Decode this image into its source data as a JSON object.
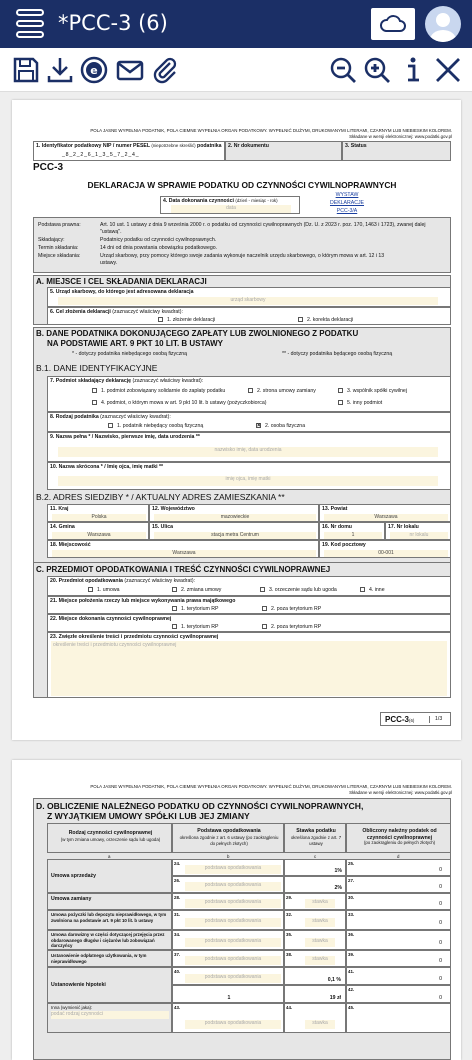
{
  "app": {
    "title": "*PCC-3 (6)"
  },
  "header_hint": "POLA JASNE WYPEŁNIA PODATNIK, POLA CIEMNE WYPEŁNIA ORGAN PODATKOWY. WYPEŁNIĆ DUŻYMI, DRUKOWANYMI LITERAMI, CZARNYM LUB NIEBIESKIM KOLOREM.",
  "header_hint2": "Składane w wersji elektronicznej: www.podatki.gov.pl",
  "field1": {
    "label": "1. Identyfikator podatkowy NIP / numer PESEL",
    "note": "(niepotrzebne skreślić)",
    "suffix": "podatnika",
    "value": "_8_2_2_6_1_3_5_7_2_4_"
  },
  "field2": {
    "label": "2. Nr dokumentu"
  },
  "field3": {
    "label": "3. Status"
  },
  "form_code": "PCC-3",
  "form_title": "DEKLARACJA W SPRAWIE PODATKU OD CZYNNOŚCI CYWILNOPRAWNYCH",
  "field4": {
    "label": "4. Data dokonania czynności",
    "note": "(dzień - miesiąc - rok)",
    "placeholder": "data"
  },
  "links": [
    "WYSTAW",
    "DEKLARACJE",
    "PCC-3/A"
  ],
  "legal": {
    "k1": "Podstawa prawna:",
    "v1": "Art. 10 ust. 1 ustawy z dnia 9 września 2000 r. o podatku od czynności cywilnoprawnych (Dz. U. z 2023 r. poz. 170, 1463 i 1723), zwanej dalej \"ustawą\".",
    "k2": "Składający:",
    "v2": "Podatnicy podatku od czynności cywilnoprawnych.",
    "k3": "Termin składania:",
    "v3": "14 dni od dnia powstania obowiązku podatkowego.",
    "k4": "Miejsce składania:",
    "v4": "Urząd skarbowy, przy pomocy którego swoje zadania wykonuje naczelnik urzędu skarbowego, o którym mowa w art. 12 i 13 ustawy."
  },
  "secA": {
    "title": "A. MIEJSCE I CEL SKŁADANIA DEKLARACJI",
    "f5": "5. Urząd skarbowy, do którego jest adresowana deklaracja",
    "f5_ph": "urząd skarbowy",
    "f6": "6. Cel złożenia deklaracji",
    "f6_note": "(zaznaczyć właściwy kwadrat):",
    "opt1": "1. złożenie deklaracji",
    "opt2": "2. korekta deklaracji"
  },
  "secB": {
    "title1": "B. DANE PODATNIKA DOKONUJĄCEGO ZAPŁATY LUB ZWOLNIONEGO Z PODATKU",
    "title2": "NA PODSTAWIE ART. 9 PKT 10 LIT. B USTAWY",
    "note1": "* - dotyczy podatnika niebędącego osobą fizyczną",
    "note2": "** - dotyczy podatnika będącego osobą fizyczną",
    "b1": "B.1. DANE IDENTYFIKACYJNE",
    "f7": "7. Podmiot składający deklarację",
    "f7_note": "(zaznaczyć właściwy kwadrat):",
    "f7_opts": [
      "1. podmiot zobowiązany solidarnie do zapłaty podatku",
      "2. strona umowy zamiany",
      "3. wspólnik spółki cywilnej",
      "4. podmiot, o którym mowa w art. 9 pkt 10 lit. b ustawy (pożyczkobiorca)",
      "5. inny podmiot"
    ],
    "f8": "8. Rodzaj podatnika",
    "f8_note": "(zaznaczyć właściwy kwadrat):",
    "f8_opts": [
      "1. podatnik niebędący osobą fizyczną",
      "2. osoba fizyczna"
    ],
    "f9": "9. Nazwa pełna * / Nazwisko, pierwsze imię, data urodzenia **",
    "f9_ph": "nazwisko imię, data urodzenia",
    "f10": "10. Nazwa skrócona * / Imię ojca, imię matki **",
    "f10_ph": "imię ojca, imię matki",
    "b2": "B.2. ADRES SIEDZIBY * / AKTUALNY ADRES ZAMIESZKANIA **",
    "addr": {
      "f11": "11. Kraj",
      "v11": "Polska",
      "f12": "12. Województwo",
      "v12": "mazowieckie",
      "f13": "13. Powiat",
      "v13": "Warszawa",
      "f14": "14. Gmina",
      "v14": "Warszawa",
      "f15": "15. Ulica",
      "v15": "stacja metra Centrum",
      "f16": "16. Nr domu",
      "v16": "1",
      "f17": "17. Nr lokalu",
      "v17": "nr lokalu",
      "f18": "18. Miejscowość",
      "v18": "Warszawa",
      "f19": "19. Kod pocztowy",
      "v19": "00-001"
    }
  },
  "secC": {
    "title": "C. PRZEDMIOT OPODATKOWANIA I TREŚĆ CZYNNOŚCI CYWILNOPRAWNEJ",
    "f20": "20. Przedmiot opodatkowania",
    "f20_note": "(zaznaczyć właściwy kwadrat):",
    "f20_opts": [
      "1. umowa",
      "2. zmiana umowy",
      "3. orzeczenie sądu lub ugoda",
      "4. inne"
    ],
    "f21": "21. Miejsce położenia rzeczy lub miejsce wykonywania prawa majątkowego",
    "f21_opts": [
      "1. terytorium RP",
      "2. poza terytorium RP"
    ],
    "f22": "22. Miejsce dokonania czynności cywilnoprawnej",
    "f22_opts": [
      "1. terytorium RP",
      "2. poza terytorium RP"
    ],
    "f23": "23. Zwięzłe określenie treści i przedmiotu czynności cywilnoprawnej",
    "f23_ph": "określenie treści i przedmiotu czynności cywilnoprawnej"
  },
  "footer": {
    "code": "PCC-3",
    "ver": "(6)",
    "page": "1/3"
  },
  "secD": {
    "title1": "D. OBLICZENIE NALEŻNEGO PODATKU OD CZYNNOŚCI CYWILNOPRAWNYCH,",
    "title2": "Z WYJĄTKIEM UMOWY SPÓŁKI LUB JEJ ZMIANY",
    "col_a": "Rodzaj czynności cywilnoprawnej",
    "col_a2": "(w tym zmiana umowy, orzeczenie sądu lub ugoda)",
    "col_b": "Podstawa opodatkowania",
    "col_b2": "określona zgodnie z art. 6 ustawy (po zaokrągleniu do pełnych złotych)",
    "col_c": "Stawka podatku",
    "col_c2": "określona zgodnie z art. 7 ustawy",
    "col_d": "Obliczony należny podatek od czynności cywilnoprawnej",
    "col_d2": "(po zaokrągleniu do pełnych złotych)",
    "letters": [
      "a",
      "b",
      "c",
      "d"
    ],
    "unit_zl": "zł",
    "rows": [
      {
        "label": "Umowa sprzedaży",
        "nb": "24.",
        "nc": "25.",
        "b": "podstawa opodatkowania",
        "c": "1%",
        "d": "0",
        "nb2": "26.",
        "nc2": "27.",
        "c2": "2%",
        "d2": "0"
      },
      {
        "label": "Umowa zamiany",
        "nb": "28.",
        "nc": "29.",
        "nd": "30.",
        "b": "podstawa opodatkowania",
        "c": "stawka",
        "d": "0"
      },
      {
        "label": "Umowa pożyczki lub depozytu nieprawidłowego, w tym zwolniona na podstawie art. 9 pkt 10 lit. b ustawy",
        "nb": "31.",
        "nc": "32.",
        "nd": "33.",
        "b": "podstawa opodatkowania",
        "c": "stawka",
        "d": "0"
      },
      {
        "label": "Umowa darowizny w części dotyczącej przejęcia przez obdarowanego długów i ciężarów lub zobowiązań darczyńcy",
        "nb": "34.",
        "nc": "35.",
        "nd": "36.",
        "b": "podstawa opodatkowania",
        "c": "stawka",
        "d": "0"
      },
      {
        "label": "Ustanowienie odpłatnego użytkowania, w tym nieprawidłowego",
        "nb": "37.",
        "nc": "38.",
        "nd": "39.",
        "b": "podstawa opodatkowania",
        "c": "stawka",
        "d": "0"
      },
      {
        "label": "Ustanowienie hipoteki",
        "nb": "40.",
        "nd": "41.",
        "b": "podstawa opodatkowania",
        "c": "0,1",
        "d": "0",
        "b2": "1",
        "c2": "19 zł",
        "nd2": "42.",
        "d2": "0"
      },
      {
        "label": "Inna (wymienić jaka):",
        "label_ph": "podać rodzaj czynności",
        "nb": "43.",
        "nc": "44.",
        "nd": "45.",
        "b": "podstawa opodatkowania",
        "c": "stawka"
      }
    ]
  }
}
